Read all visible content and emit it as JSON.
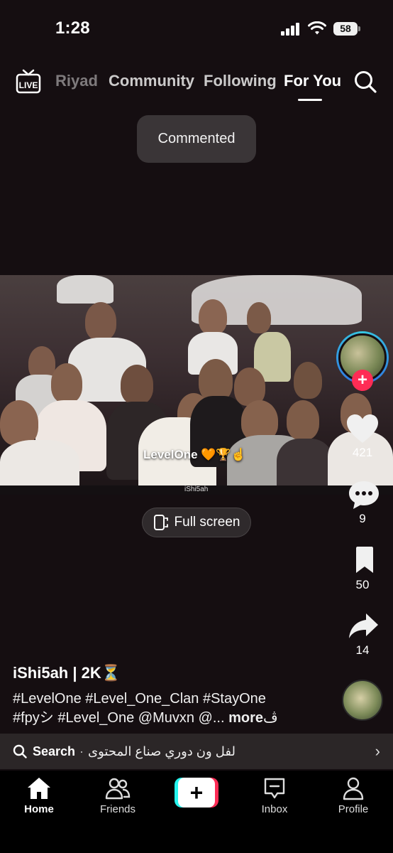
{
  "status_bar": {
    "time": "1:28",
    "battery": "58"
  },
  "top_nav": {
    "live_label": "LIVE",
    "tabs": [
      {
        "label": "Riyad"
      },
      {
        "label": "Community"
      },
      {
        "label": "Following"
      },
      {
        "label": "For You",
        "active": true
      }
    ]
  },
  "toast": {
    "text": "Commented"
  },
  "video": {
    "caption": "LevelOne 🧡🏆☝️",
    "watermark": "iShi5ah"
  },
  "fullscreen": {
    "label": "Full screen"
  },
  "actions": {
    "likes": "421",
    "comments": "9",
    "saves": "50",
    "shares": "14"
  },
  "post": {
    "author": "iShi5ah | 2K⏳",
    "description_line1": "#LevelOne #Level_One_Clan #StayOne",
    "description_line2": "#fpyシ #Level_One  @Muvxn @...",
    "more": "more",
    "more_suffix": "ڤ"
  },
  "search_bar": {
    "label": "Search",
    "separator": "·",
    "query": "لفل ون دوري صناع المحتوى"
  },
  "bottom_nav": {
    "items": [
      {
        "label": "Home",
        "active": true
      },
      {
        "label": "Friends"
      },
      {
        "label": "Inbox"
      },
      {
        "label": "Profile"
      }
    ]
  },
  "colors": {
    "background": "#150e11",
    "accent_red": "#fe2c55",
    "accent_cyan": "#25f4ee"
  }
}
